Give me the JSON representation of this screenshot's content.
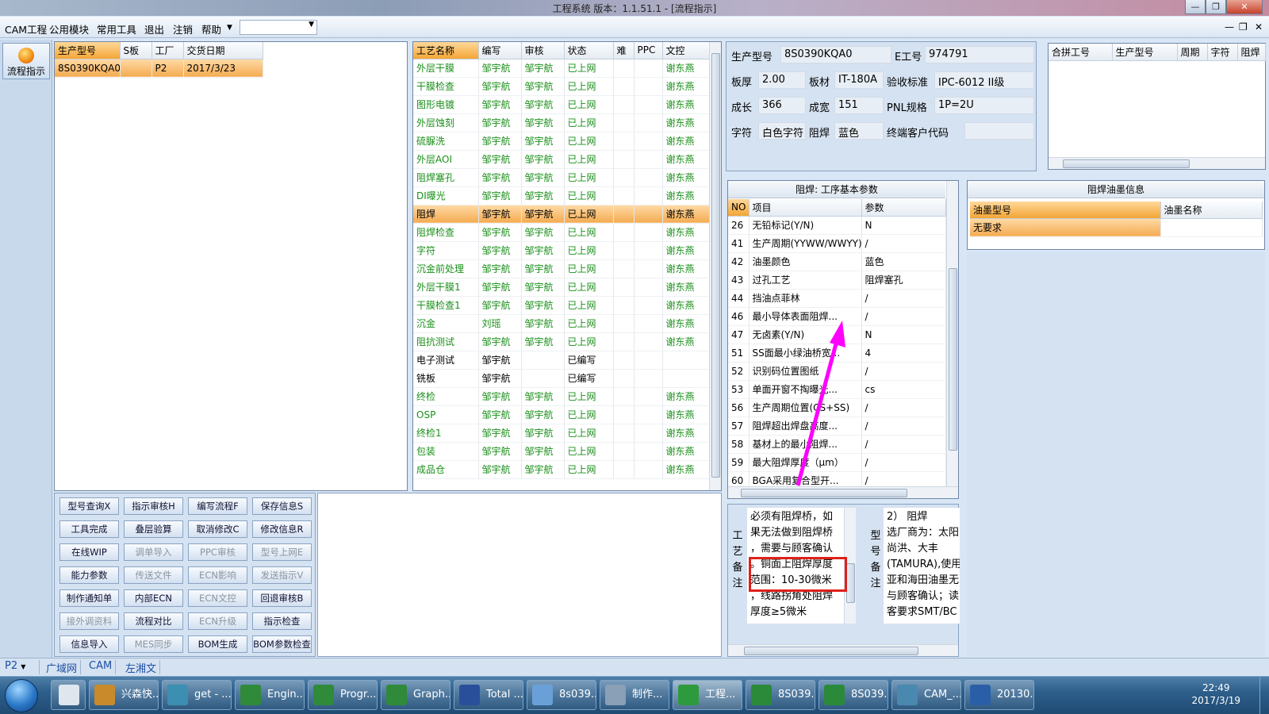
{
  "window": {
    "title": "工程系统  版本：1.1.51.1 - [流程指示]"
  },
  "menu": {
    "items": [
      "CAM工程",
      "公用模块",
      "常用工具",
      "退出",
      "注销",
      "帮助"
    ],
    "combo_value": ""
  },
  "leftbar": {
    "flow_label": "流程指示"
  },
  "orders": {
    "headers": [
      "生产型号",
      "S板",
      "工厂",
      "交货日期"
    ],
    "rows": [
      [
        "8S0390KQA0",
        "",
        "P2",
        "2017/3/23"
      ]
    ]
  },
  "process": {
    "headers": [
      "工艺名称",
      "编写",
      "审核",
      "状态",
      "难",
      "PPC",
      "文控"
    ],
    "rows": [
      [
        "外层干膜",
        "邹宇航",
        "邹宇航",
        "已上网",
        "",
        "",
        "谢东燕"
      ],
      [
        "干膜检查",
        "邹宇航",
        "邹宇航",
        "已上网",
        "",
        "",
        "谢东燕"
      ],
      [
        "图形电镀",
        "邹宇航",
        "邹宇航",
        "已上网",
        "",
        "",
        "谢东燕"
      ],
      [
        "外层蚀刻",
        "邹宇航",
        "邹宇航",
        "已上网",
        "",
        "",
        "谢东燕"
      ],
      [
        "硫脲洗",
        "邹宇航",
        "邹宇航",
        "已上网",
        "",
        "",
        "谢东燕"
      ],
      [
        "外层AOI",
        "邹宇航",
        "邹宇航",
        "已上网",
        "",
        "",
        "谢东燕"
      ],
      [
        "阻焊塞孔",
        "邹宇航",
        "邹宇航",
        "已上网",
        "",
        "",
        "谢东燕"
      ],
      [
        "DI曝光",
        "邹宇航",
        "邹宇航",
        "已上网",
        "",
        "",
        "谢东燕"
      ],
      [
        "阻焊",
        "邹宇航",
        "邹宇航",
        "已上网",
        "",
        "",
        "谢东燕"
      ],
      [
        "阻焊检查",
        "邹宇航",
        "邹宇航",
        "已上网",
        "",
        "",
        "谢东燕"
      ],
      [
        "字符",
        "邹宇航",
        "邹宇航",
        "已上网",
        "",
        "",
        "谢东燕"
      ],
      [
        "沉金前处理",
        "邹宇航",
        "邹宇航",
        "已上网",
        "",
        "",
        "谢东燕"
      ],
      [
        "外层干膜1",
        "邹宇航",
        "邹宇航",
        "已上网",
        "",
        "",
        "谢东燕"
      ],
      [
        "干膜检查1",
        "邹宇航",
        "邹宇航",
        "已上网",
        "",
        "",
        "谢东燕"
      ],
      [
        "沉金",
        "刘瑶",
        "邹宇航",
        "已上网",
        "",
        "",
        "谢东燕"
      ],
      [
        "阻抗测试",
        "邹宇航",
        "邹宇航",
        "已上网",
        "",
        "",
        "谢东燕"
      ],
      [
        "电子测试",
        "邹宇航",
        "",
        "已编写",
        "",
        "",
        ""
      ],
      [
        "铣板",
        "邹宇航",
        "",
        "已编写",
        "",
        "",
        ""
      ],
      [
        "终检",
        "邹宇航",
        "邹宇航",
        "已上网",
        "",
        "",
        "谢东燕"
      ],
      [
        "OSP",
        "邹宇航",
        "邹宇航",
        "已上网",
        "",
        "",
        "谢东燕"
      ],
      [
        "终检1",
        "邹宇航",
        "邹宇航",
        "已上网",
        "",
        "",
        "谢东燕"
      ],
      [
        "包装",
        "邹宇航",
        "邹宇航",
        "已上网",
        "",
        "",
        "谢东燕"
      ],
      [
        "成品仓",
        "邹宇航",
        "邹宇航",
        "已上网",
        "",
        "",
        "谢东燕"
      ]
    ]
  },
  "buttons": [
    [
      "型号查询X",
      "指示审核H",
      "编写流程F",
      "保存信息S"
    ],
    [
      "工具完成",
      "叠层验算",
      "取消修改C",
      "修改信息R"
    ],
    [
      "在线WIP",
      "调单导入",
      "PPC审核",
      "型号上网E"
    ],
    [
      "能力参数",
      "传送文件",
      "ECN影响",
      "发送指示V"
    ],
    [
      "制作通知单",
      "内部ECN",
      "ECN文控",
      "回退审核B"
    ],
    [
      "接外调资料",
      "流程对比",
      "ECN升级",
      "指示检查"
    ],
    [
      "信息导入",
      "MES同步",
      "BOM生成",
      "BOM参数检查"
    ]
  ],
  "info": {
    "model_label": "生产型号",
    "model": "8S0390KQA0",
    "e_label": "E工号",
    "e_no": "974791",
    "thick_label": "板厚",
    "thick": "2.00",
    "mat_label": "板材",
    "mat": "IT-180A",
    "std_label": "验收标准",
    "std": "IPC-6012 II级",
    "len_label": "成长",
    "len": "366",
    "wid_label": "成宽",
    "wid": "151",
    "pnl_label": "PNL规格",
    "pnl": "1P=2U",
    "char_label": "字符",
    "char": "白色字符",
    "mask_label": "阻焊",
    "mask": "蓝色",
    "cust_label": "终端客户代码",
    "cust": ""
  },
  "merge": {
    "headers": [
      "合拼工号",
      "生产型号",
      "周期",
      "字符",
      "阻焊"
    ]
  },
  "params": {
    "title": "阻焊: 工序基本参数",
    "headers": [
      "NO",
      "项目",
      "参数"
    ],
    "rows": [
      [
        "26",
        "无铅标记(Y/N)",
        "N"
      ],
      [
        "41",
        "生产周期(YYWW/WWYY)",
        "/"
      ],
      [
        "42",
        "油墨颜色",
        "蓝色"
      ],
      [
        "43",
        "过孔工艺",
        "阻焊塞孔"
      ],
      [
        "44",
        "挡油点菲林",
        "/"
      ],
      [
        "46",
        "最小导体表面阻焊...",
        "/"
      ],
      [
        "47",
        "无卤素(Y/N)",
        "N"
      ],
      [
        "51",
        "SS面最小绿油桥宽...",
        "4"
      ],
      [
        "52",
        "识别码位置图纸",
        "/"
      ],
      [
        "53",
        "单面开窗不掏曝光...",
        "cs"
      ],
      [
        "56",
        "生产周期位置(CS+SS)",
        "/"
      ],
      [
        "57",
        "阻焊超出焊盘高度...",
        "/"
      ],
      [
        "58",
        "基材上的最小阻焊...",
        "/"
      ],
      [
        "59",
        "最大阻焊厚度（μm）",
        "/"
      ],
      [
        "60",
        "BGA采用复合型开...",
        "/"
      ]
    ]
  },
  "ink": {
    "title": "阻焊油墨信息",
    "headers": [
      "油墨型号",
      "油墨名称"
    ],
    "row": [
      "无要求",
      ""
    ]
  },
  "remarks": {
    "process_label": "工艺备注",
    "process_lines": [
      "必须有阻焊桥，如",
      "果无法做到阻焊桥",
      "，需要与顾客确认",
      "。铜面上阻焊厚度",
      "范围：10-30微米",
      "，线路拐角处阻焊",
      "厚度≥5微米"
    ],
    "model_label": "型号备注",
    "model_lines": [
      "2）    阻焊",
      "选厂商为：太阳",
      "尚洪、大丰",
      "(TAMURA),使用",
      "亚和海田油墨无",
      "与顾客确认；读",
      "客要求SMT/BC"
    ]
  },
  "status": {
    "tabs": [
      "P2",
      "广域网",
      "CAM",
      "左湘文"
    ]
  },
  "taskbar": {
    "items": [
      "兴森快...",
      "get - ...",
      "Engin...",
      "Progr...",
      "Graph...",
      "Total ...",
      "8s039...",
      "制作...",
      "工程...",
      "8S039...",
      "8S039...",
      "CAM_...",
      "20130..."
    ],
    "time": "22:49",
    "date": "2017/3/19"
  },
  "colors": {
    "green_text": "#1a8f1a",
    "highlight": "#f4ab52",
    "annotation": "#ff00ff",
    "box": "#e0201a"
  }
}
